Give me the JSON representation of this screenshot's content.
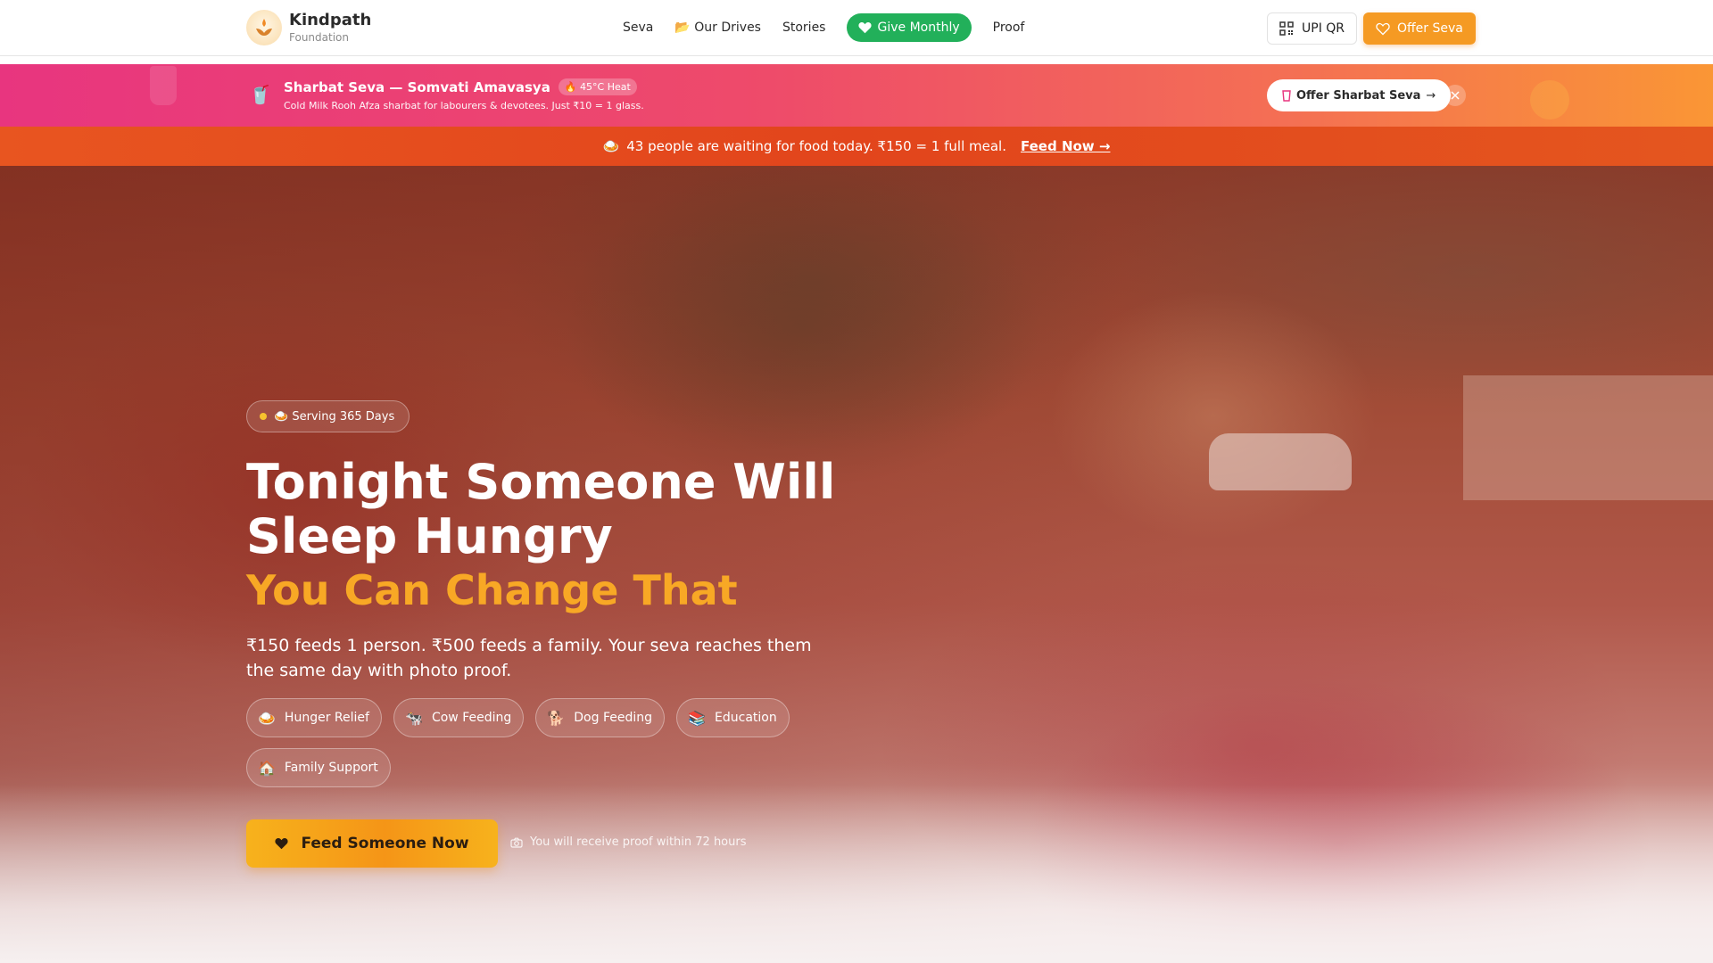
{
  "header": {
    "brand_name": "Kindpath",
    "brand_sub": "Foundation",
    "nav": [
      {
        "label": "Seva"
      },
      {
        "label": "📂 Our Drives"
      },
      {
        "label": "Stories"
      },
      {
        "label": "Give Monthly",
        "icon": "heart-icon",
        "highlighted": true
      },
      {
        "label": "Proof"
      }
    ],
    "upi_label": "UPI QR",
    "offer_label": "Offer Seva"
  },
  "promo": {
    "icon": "🥤",
    "title": "Sharbat Seva — Somvati Amavasya",
    "badge": "🔥 45°C Heat",
    "subtitle": "Cold Milk Rooh Afza sharbat for labourers & devotees. Just ₹10 = 1 glass.",
    "cta": "Offer Sharbat Seva",
    "cta_arrow": "→"
  },
  "urgency": {
    "icon": "🍛",
    "text": "43 people are waiting for food today. ₹150 = 1 full meal.",
    "link": "Feed Now →"
  },
  "hero": {
    "badge": "🍛 Serving 365 Days",
    "title": "Tonight Someone Will Sleep Hungry",
    "accent": "You Can Change That",
    "description": "₹150 feeds 1 person. ₹500 feeds a family. Your seva reaches them the same day with photo proof.",
    "chips": [
      {
        "emoji": "🍛",
        "label": "Hunger Relief"
      },
      {
        "emoji": "🐄",
        "label": "Cow Feeding"
      },
      {
        "emoji": "🐕",
        "label": "Dog Feeding"
      },
      {
        "emoji": "📚",
        "label": "Education"
      },
      {
        "emoji": "🏠",
        "label": "Family Support"
      }
    ],
    "cta": "Feed Someone Now",
    "proof_note": "You will receive proof within 72 hours"
  },
  "colors": {
    "brand_green": "#22b05a",
    "brand_orange": "#f59a23",
    "promo_pink": "#e8357f",
    "urgency_red": "#e2451c",
    "accent_yellow": "#f8a825"
  }
}
